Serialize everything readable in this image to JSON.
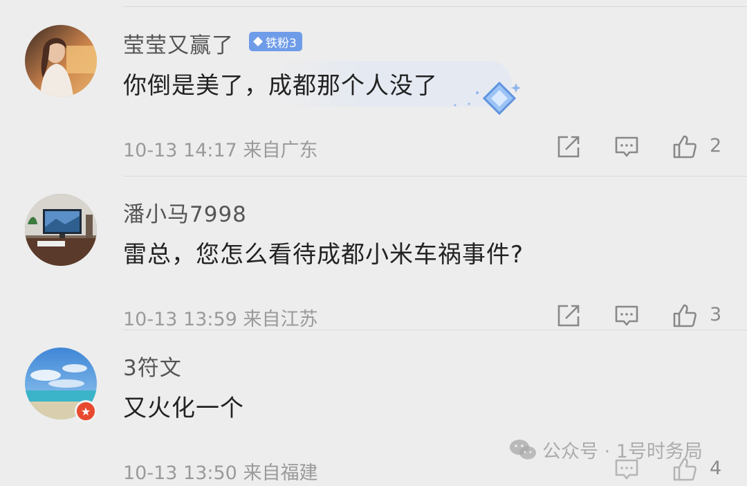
{
  "comments": [
    {
      "username": "莹莹又赢了",
      "badge": "铁粉3",
      "text": "你倒是美了，成都那个人没了",
      "time": "10-13 14:17",
      "location": "来自广东",
      "likes": "2"
    },
    {
      "username": "潘小马7998",
      "text": "雷总，您怎么看待成都小米车祸事件?",
      "time": "10-13 13:59",
      "location": "来自江苏",
      "likes": "3"
    },
    {
      "username": "3符文",
      "text": "又火化一个",
      "time": "10-13 13:50",
      "location": "来自福建",
      "likes": "4"
    }
  ],
  "watermark": "公众号 · 1号时务局",
  "icons": {
    "share": "share-icon",
    "reply": "comment-icon",
    "like": "thumbs-up-icon",
    "verified": "verified-star-badge-icon",
    "wechat": "wechat-icon"
  },
  "colors": {
    "background": "#ededed",
    "badge": "#6f9ce8",
    "meta_text": "#9a9a9a",
    "verified_badge": "#e8492f"
  }
}
